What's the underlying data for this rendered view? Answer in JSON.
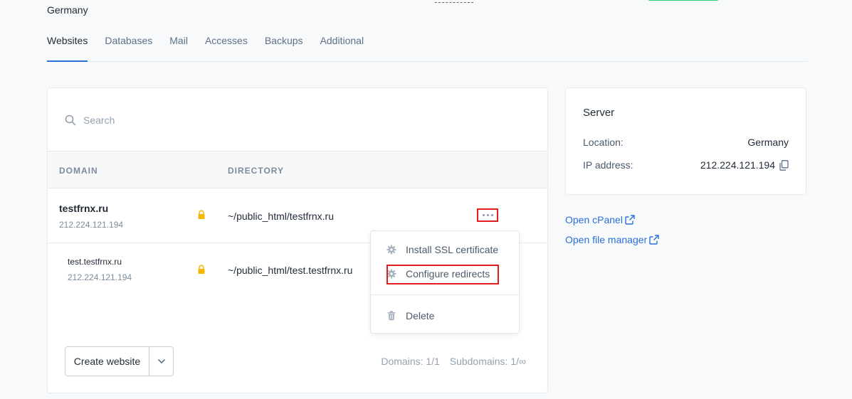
{
  "header": {
    "location": "Germany"
  },
  "tabs": [
    {
      "label": "Websites",
      "active": true
    },
    {
      "label": "Databases"
    },
    {
      "label": "Mail"
    },
    {
      "label": "Accesses"
    },
    {
      "label": "Backups"
    },
    {
      "label": "Additional"
    }
  ],
  "search": {
    "placeholder": "Search",
    "value": ""
  },
  "table": {
    "columns": [
      "DOMAIN",
      "DIRECTORY"
    ],
    "rows": [
      {
        "domain": "testfrnx.ru",
        "ip": "212.224.121.194",
        "directory": "~/public_html/testfrnx.ru"
      },
      {
        "domain": "test.testfrnx.ru",
        "ip": "212.224.121.194",
        "directory": "~/public_html/test.testfrnx.ru"
      }
    ]
  },
  "menu": {
    "install_ssl": "Install SSL certificate",
    "configure_redirects": "Configure redirects",
    "delete": "Delete"
  },
  "footer": {
    "create_label": "Create website",
    "domains": "Domains: 1/1",
    "subdomains": "Subdomains: 1/∞"
  },
  "server": {
    "title": "Server",
    "location_label": "Location:",
    "location_value": "Germany",
    "ip_label": "IP address:",
    "ip_value": "212.224.121.194"
  },
  "links": {
    "cpanel": "Open cPanel",
    "file_manager": "Open file manager"
  },
  "colors": {
    "accent": "#2b6fd6",
    "highlight": "#e11d1d",
    "lock": "#f5b800"
  }
}
